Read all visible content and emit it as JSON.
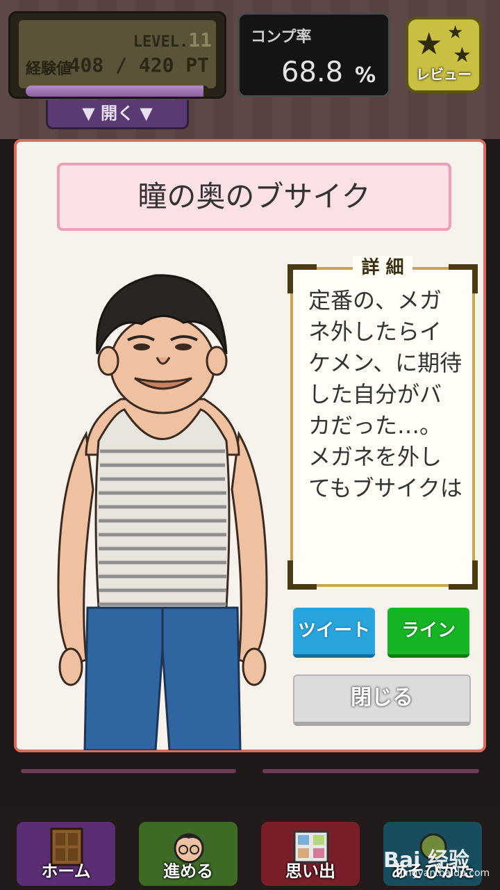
{
  "hud": {
    "level_label": "LEVEL.",
    "level_value": "11",
    "exp_label": "経験値",
    "exp_value": "408 / 420 PT",
    "exp_progress": 0.971,
    "open_label": "▼ 開く ▼",
    "completion_label": "コンプ率",
    "completion_value": "68.8",
    "completion_unit": "%",
    "review_label": "レビュー"
  },
  "dialog": {
    "title": "瞳の奥のブサイク",
    "detail_label": "詳 細",
    "detail_text": "定番の、メガネ外したらイケメン、に期待した自分がバカだった…。メガネを外してもブサイクはブサイクだった。",
    "tweet_label": "ツイート",
    "line_label": "ライン",
    "close_label": "閉じる"
  },
  "nav": {
    "home": "ホーム",
    "go": "進める",
    "memories": "思い出",
    "help": "あそびかた"
  },
  "watermark": {
    "brand": "Bai 经验",
    "url": "jingyan.baidu.com"
  },
  "colors": {
    "panel_border": "#d96b63",
    "title_bg": "#fbe0e6",
    "tweet": "#2aa4dc",
    "line": "#17b526"
  }
}
